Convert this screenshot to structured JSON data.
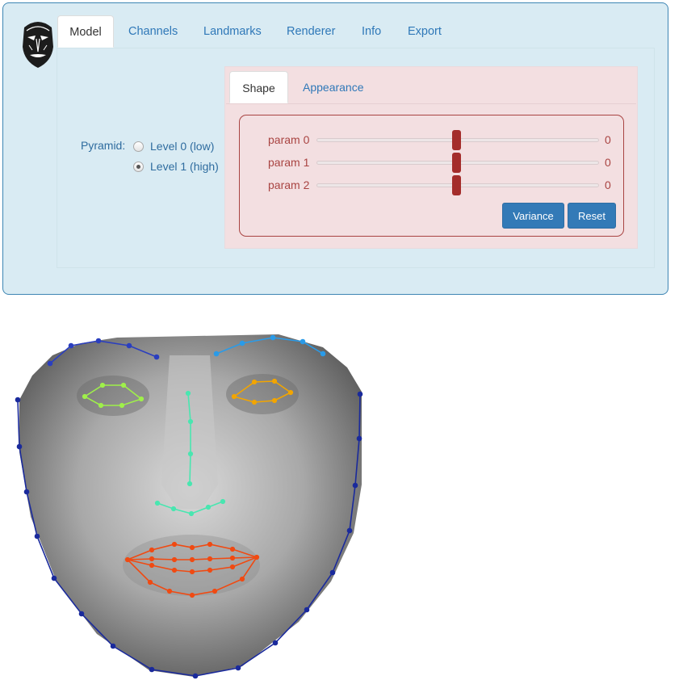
{
  "tabs": [
    "Model",
    "Channels",
    "Landmarks",
    "Renderer",
    "Info",
    "Export"
  ],
  "pyramid": {
    "label": "Pyramid:",
    "options": [
      "Level 0 (low)",
      "Level 1 (high)"
    ],
    "selected": "Level 1 (high)"
  },
  "subtabs": [
    "Shape",
    "Appearance"
  ],
  "params": [
    {
      "label": "param 0",
      "value": "0"
    },
    {
      "label": "param 1",
      "value": "0"
    },
    {
      "label": "param 2",
      "value": "0"
    }
  ],
  "slider_fraction": 0.5,
  "buttons": {
    "variance": "Variance",
    "reset": "Reset"
  },
  "colors": {
    "panel_bg": "#d9ebf3",
    "shape_panel_bg": "#f3dfe1",
    "danger": "#a94442",
    "primary": "#337ab7",
    "jaw": "#1a2a9c",
    "brow_left": "#2b3fbf",
    "brow_right": "#2a9be8",
    "eye_left": "#9ff04a",
    "eye_right": "#f2a500",
    "nose": "#49e6b0",
    "mouth": "#f04a12"
  }
}
